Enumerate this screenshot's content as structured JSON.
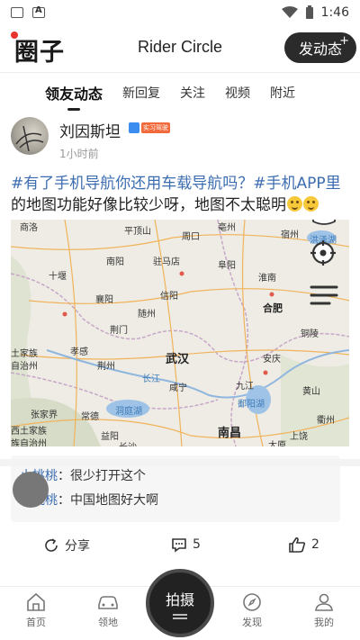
{
  "status_bar": {
    "time": "1:46"
  },
  "header": {
    "logo": "圈子",
    "title": "Rider Circle",
    "post_button": "发动态",
    "post_button_plus": "+"
  },
  "tabs": [
    {
      "label": "领友动态",
      "active": true
    },
    {
      "label": "新回复"
    },
    {
      "label": "关注"
    },
    {
      "label": "视频"
    },
    {
      "label": "附近"
    }
  ],
  "post": {
    "username": "刘因斯坦",
    "badge": "实习驾驶",
    "time": "1小时前",
    "text_tag1": "#有了手机导航你还用车载导航吗？",
    "text_tag2": "#手机APP里",
    "text_rest": "的地图功能好像比较少呀，地图不太聪明",
    "map_labels": {
      "shangyang": "商洛",
      "pingdingshan": "平顶山",
      "zhoukou": "周口",
      "bozhou": "亳州",
      "suzhou": "宿州",
      "hongzehu": "洪泽湖",
      "nanyang": "南阳",
      "zhumadian": "驻马店",
      "fuyang": "阜阳",
      "huainan": "淮南",
      "shiyan": "十堰",
      "xinyang": "信阳",
      "xiangyang": "襄阳",
      "hefei": "合肥",
      "suizhou": "随州",
      "jingmen": "荆门",
      "tongling": "铜陵",
      "tujia1": "土家族",
      "zizhizhou1": "自治州",
      "xiaogan": "孝感",
      "jingzhou": "荆州",
      "wuhan": "武汉",
      "anqing": "安庆",
      "changjiang": "长江",
      "xianning": "咸宁",
      "jiujiang": "九江",
      "huangshan": "黄山",
      "zhangjiajie": "张家界",
      "changde": "常德",
      "dongtinghu": "洞庭湖",
      "poyanghu": "鄱阳湖",
      "quzhou": "衢州",
      "tujia2": "西土家族",
      "zizhizhou2": "族自治州",
      "yiyang": "益阳",
      "nanchang": "南昌",
      "shangrao": "上饶",
      "changsha": "长沙",
      "tai": "太原"
    }
  },
  "comments": [
    {
      "name": "小桃桃",
      "text": "：很少打开这个"
    },
    {
      "name": "小桃桃",
      "text": "：中国地图好大啊"
    }
  ],
  "actions": {
    "share": "分享",
    "comments": "5",
    "likes": "2"
  },
  "bottom_nav": [
    {
      "label": "首页"
    },
    {
      "label": "领地"
    },
    {
      "label": "发现"
    },
    {
      "label": "我的"
    }
  ],
  "shoot_button": "拍摄"
}
